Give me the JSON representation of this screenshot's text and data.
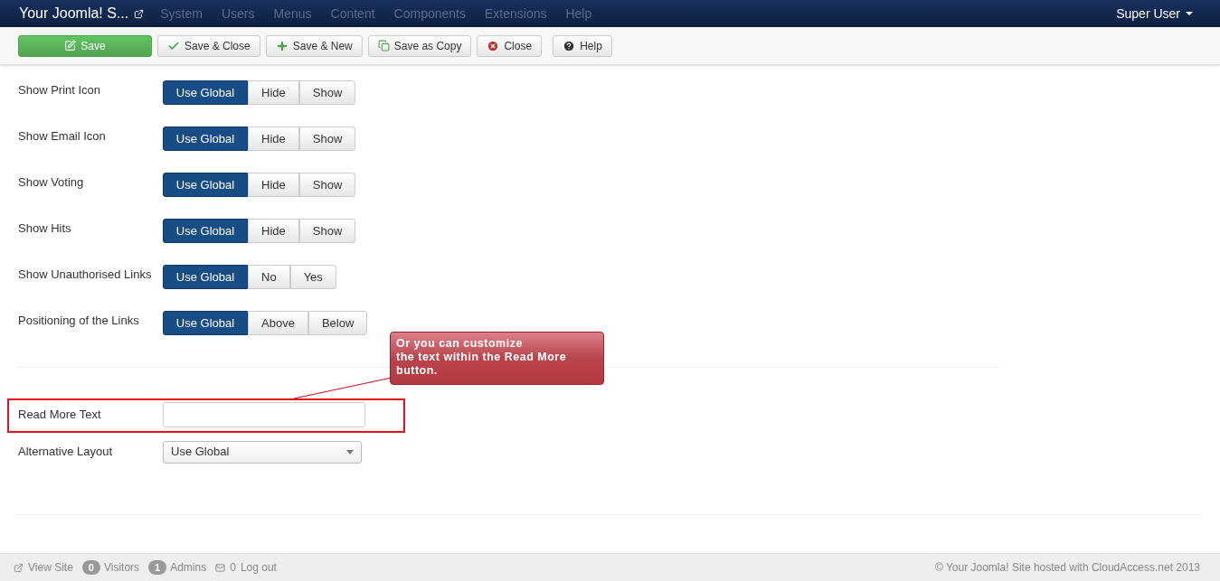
{
  "navbar": {
    "brand": "Your Joomla! S...",
    "menu": [
      "System",
      "Users",
      "Menus",
      "Content",
      "Components",
      "Extensions",
      "Help"
    ],
    "user": "Super User"
  },
  "toolbar": [
    {
      "kind": "save",
      "label": "Save"
    },
    {
      "kind": "check",
      "label": "Save & Close"
    },
    {
      "kind": "plus",
      "label": "Save & New"
    },
    {
      "kind": "copy",
      "label": "Save as Copy"
    },
    {
      "kind": "close",
      "label": "Close"
    },
    {
      "kind": "help",
      "label": "Help"
    }
  ],
  "toggles": [
    {
      "label": "Show Print Icon",
      "options": [
        {
          "label": "Use Global",
          "selected": true
        },
        {
          "label": "Hide",
          "selected": false
        },
        {
          "label": "Show",
          "selected": false
        }
      ]
    },
    {
      "label": "Show Email Icon",
      "options": [
        {
          "label": "Use Global",
          "selected": true
        },
        {
          "label": "Hide",
          "selected": false
        },
        {
          "label": "Show",
          "selected": false
        }
      ]
    },
    {
      "label": "Show Voting",
      "options": [
        {
          "label": "Use Global",
          "selected": true
        },
        {
          "label": "Hide",
          "selected": false
        },
        {
          "label": "Show",
          "selected": false
        }
      ]
    },
    {
      "label": "Show Hits",
      "options": [
        {
          "label": "Use Global",
          "selected": true
        },
        {
          "label": "Hide",
          "selected": false
        },
        {
          "label": "Show",
          "selected": false
        }
      ]
    },
    {
      "label": "Show Unauthorised Links",
      "options": [
        {
          "label": "Use Global",
          "selected": true
        },
        {
          "label": "No",
          "selected": false
        },
        {
          "label": "Yes",
          "selected": false
        }
      ]
    },
    {
      "label": "Positioning of the Links",
      "options": [
        {
          "label": "Use Global",
          "selected": true
        },
        {
          "label": "Above",
          "selected": false
        },
        {
          "label": "Below",
          "selected": false
        }
      ]
    }
  ],
  "callout": [
    "Or you can customize",
    "the text within the Read More",
    "button."
  ],
  "read_more": {
    "label": "Read More Text"
  },
  "layout_select": {
    "label": "Alternative Layout",
    "value": "Use Global"
  },
  "footer": {
    "view_site": "View Site",
    "visitors_count": "0",
    "visitors": "Visitors",
    "admins_count": "1",
    "admins": "Admins",
    "messages": "0",
    "logout": "Log out",
    "copyright": "© Your Joomla! Site hosted with CloudAccess.net 2013"
  }
}
